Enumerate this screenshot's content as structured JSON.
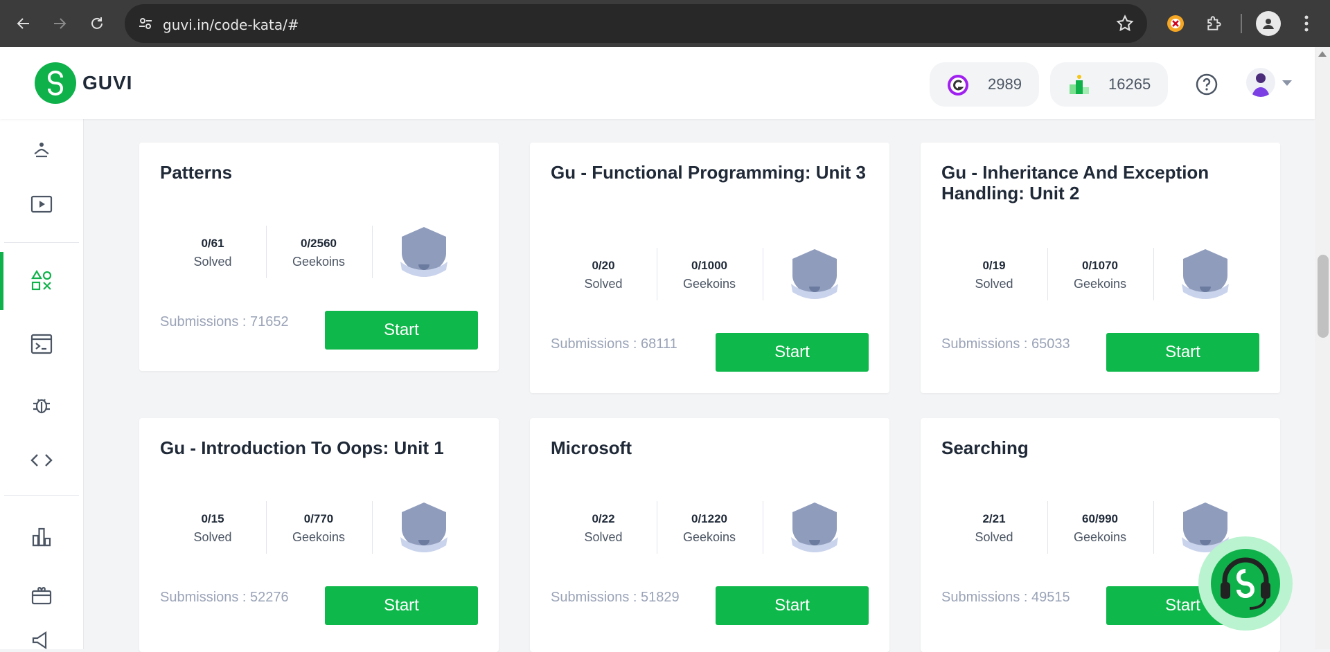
{
  "browser": {
    "url": "guvi.in/code-kata/#"
  },
  "header": {
    "logo_text": "GUVI",
    "geekoins_value": "2989",
    "rank_value": "16265"
  },
  "cards": [
    {
      "title": "Patterns",
      "solved": "0/61",
      "solved_label": "Solved",
      "geekoins": "0/2560",
      "geekoins_label": "Geekoins",
      "submissions": "Submissions : 71652",
      "button": "Start"
    },
    {
      "title": "Gu - Functional Programming: Unit 3",
      "solved": "0/20",
      "solved_label": "Solved",
      "geekoins": "0/1000",
      "geekoins_label": "Geekoins",
      "submissions": "Submissions : 68111",
      "button": "Start"
    },
    {
      "title": "Gu - Inheritance And Exception Handling: Unit 2",
      "solved": "0/19",
      "solved_label": "Solved",
      "geekoins": "0/1070",
      "geekoins_label": "Geekoins",
      "submissions": "Submissions : 65033",
      "button": "Start"
    },
    {
      "title": "Gu - Introduction To Oops: Unit 1",
      "solved": "0/15",
      "solved_label": "Solved",
      "geekoins": "0/770",
      "geekoins_label": "Geekoins",
      "submissions": "Submissions : 52276",
      "button": "Start"
    },
    {
      "title": "Microsoft",
      "solved": "0/22",
      "solved_label": "Solved",
      "geekoins": "0/1220",
      "geekoins_label": "Geekoins",
      "submissions": "Submissions : 51829",
      "button": "Start"
    },
    {
      "title": "Searching",
      "solved": "2/21",
      "solved_label": "Solved",
      "geekoins": "60/990",
      "geekoins_label": "Geekoins",
      "submissions": "Submissions : 49515",
      "button": "Start"
    }
  ],
  "colors": {
    "brand_green": "#0fb14a",
    "button_green": "#0fb84a",
    "badge_gray": "#8f9cbc"
  }
}
